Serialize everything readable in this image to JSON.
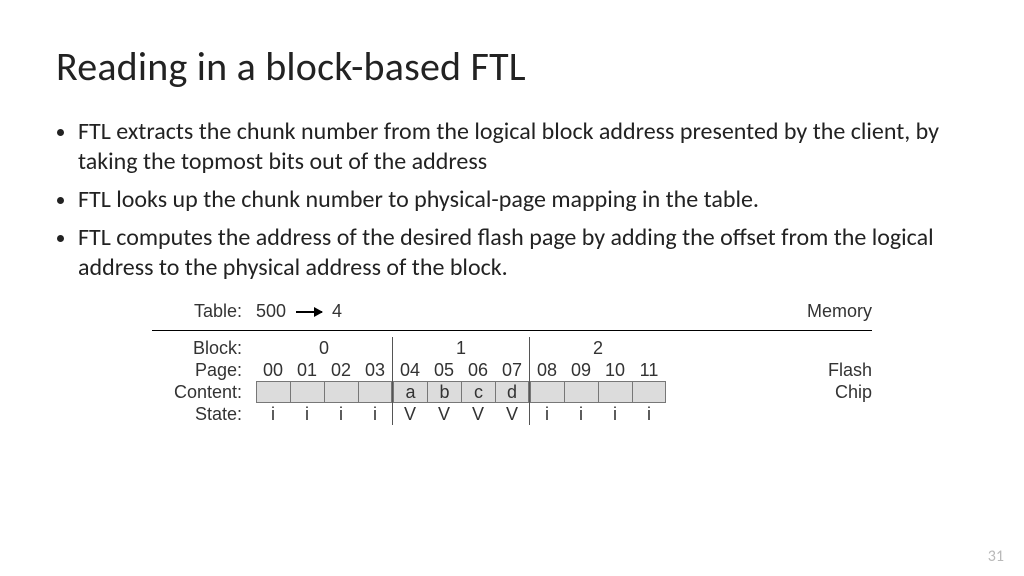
{
  "title": "Reading in a block-based FTL",
  "bullets": [
    "FTL extracts the chunk number from the logical block address presented by the client, by taking the topmost bits out of the address",
    "FTL looks up the chunk number to physical-page mapping in the table.",
    "FTL computes the address of the desired flash page by adding the offset from the logical address to the physical address of the block."
  ],
  "diagram": {
    "table_label": "Table:",
    "table_from": "500",
    "table_to": "4",
    "memory_label": "Memory",
    "row_labels": {
      "block": "Block:",
      "page": "Page:",
      "content": "Content:",
      "state": "State:"
    },
    "flash_label": "Flash",
    "chip_label": "Chip",
    "blocks": [
      {
        "name": "0",
        "pages": [
          "00",
          "01",
          "02",
          "03"
        ],
        "content": [
          "",
          "",
          "",
          ""
        ],
        "state": [
          "i",
          "i",
          "i",
          "i"
        ]
      },
      {
        "name": "1",
        "pages": [
          "04",
          "05",
          "06",
          "07"
        ],
        "content": [
          "a",
          "b",
          "c",
          "d"
        ],
        "state": [
          "V",
          "V",
          "V",
          "V"
        ]
      },
      {
        "name": "2",
        "pages": [
          "08",
          "09",
          "10",
          "11"
        ],
        "content": [
          "",
          "",
          "",
          ""
        ],
        "state": [
          "i",
          "i",
          "i",
          "i"
        ]
      }
    ]
  },
  "page_number": "31"
}
